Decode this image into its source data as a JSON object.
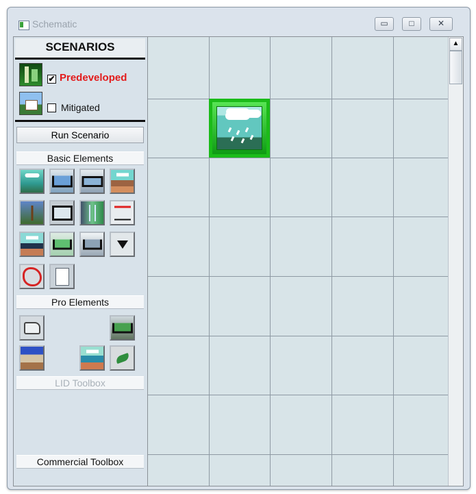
{
  "window": {
    "title": "Schematic",
    "controls": [
      "minimize-icon",
      "maximize-icon",
      "close-icon"
    ]
  },
  "scenarios": {
    "header": "SCENARIOS",
    "items": [
      {
        "label": "Predeveloped",
        "checked": true,
        "checkmark": "✔",
        "color": "#e31b1b"
      },
      {
        "label": "Mitigated",
        "checked": false,
        "checkmark": ""
      }
    ],
    "run_button": "Run Scenario"
  },
  "sections": {
    "basic": "Basic Elements",
    "pro": "Pro Elements",
    "lid": "LID Toolbox",
    "commercial": "Commercial Toolbox"
  },
  "basic_elements": [
    "rain-icon",
    "basin-icon",
    "tank-icon",
    "soil-rain-icon",
    "plant-icon",
    "vault-icon",
    "channel-icon",
    "graph-icon",
    "mix-icon",
    "pond-icon",
    "trench-icon",
    "split-icon",
    "polygon-icon",
    "report-icon"
  ],
  "pro_elements": [
    "pipe-icon",
    "green-roof-icon",
    "pervious-icon",
    "bioretention-icon",
    "leaf-icon"
  ],
  "canvas": {
    "placed_element": "rain-element-icon",
    "accent": "#1bbb19"
  },
  "scrollbar": {
    "up_arrow": "▲"
  }
}
